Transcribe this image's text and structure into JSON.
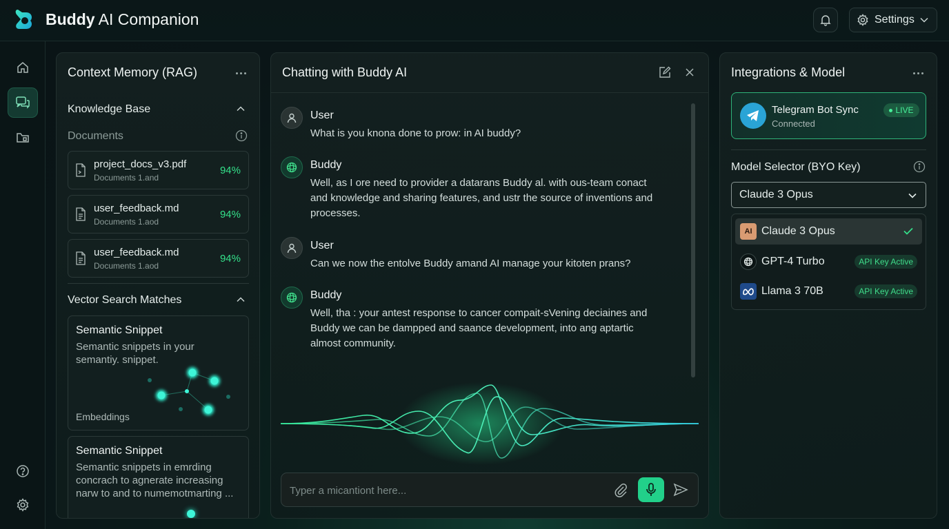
{
  "app": {
    "title_bold": "Buddy",
    "title_rest": " AI Companion"
  },
  "header": {
    "settings_label": "Settings"
  },
  "rail": {
    "items": [
      "home-icon",
      "chat-icon",
      "folder-icon"
    ],
    "bottom": [
      "help-icon",
      "gear-icon"
    ]
  },
  "memory": {
    "title": "Context Memory (RAG)",
    "knowledge_base": "Knowledge Base",
    "documents_label": "Documents",
    "docs": [
      {
        "name": "project_docs_v3.pdf",
        "sub": "Documents 1.and",
        "pct": "94%"
      },
      {
        "name": "user_feedback.md",
        "sub": "Documents 1.aod",
        "pct": "94%"
      },
      {
        "name": "user_feedback.md",
        "sub": "Documents 1.aod",
        "pct": "94%"
      }
    ],
    "vector_title": "Vector Search Matches",
    "snippets": [
      {
        "title": "Semantic Snippet",
        "body": "Semantic snippets in your semantiy. snippet.",
        "tag": "Embeddings"
      },
      {
        "title": "Semantic Snippet",
        "body": "Semantic snippets in emrding concrach to agnerate increasing narw to and to numemotmarting ..."
      }
    ]
  },
  "chat": {
    "title": "Chatting with Buddy AI",
    "messages": [
      {
        "name": "User",
        "text": "What is you knona done to prow: in AI buddy?"
      },
      {
        "name": "Buddy",
        "text": "Well, as I ore need to provider a datarans Buddy al. with ous-team conact and knowledge and sharing features, and ustr the source of inventions and processes."
      },
      {
        "name": "User",
        "text": "Can we now the entolve Buddy amand AI manage your kitoten prans?"
      },
      {
        "name": "Buddy",
        "text": "Well, tha : your antest response to cancer compait-sVening deciaines and Buddy we can be dampped and saance development, into ang aptartic almost community."
      }
    ],
    "input_placeholder": "Typer a micantiont here..."
  },
  "integrations": {
    "title": "Integrations & Model",
    "telegram": {
      "title": "Telegram Bot Sync",
      "status": "Connected",
      "badge": "LIVE"
    },
    "model_selector_label": "Model Selector (BYO Key)",
    "selected_model": "Claude 3 Opus",
    "models": [
      {
        "name": "Claude 3 Opus",
        "icon": "AI",
        "selected": true
      },
      {
        "name": "GPT-4 Turbo",
        "badge": "API Key Active"
      },
      {
        "name": "Llama 3 70B",
        "badge": "API Key Active"
      }
    ]
  },
  "colors": {
    "accent": "#22d08a",
    "accent_text": "#34e08a",
    "panel_bg": "#142020"
  }
}
